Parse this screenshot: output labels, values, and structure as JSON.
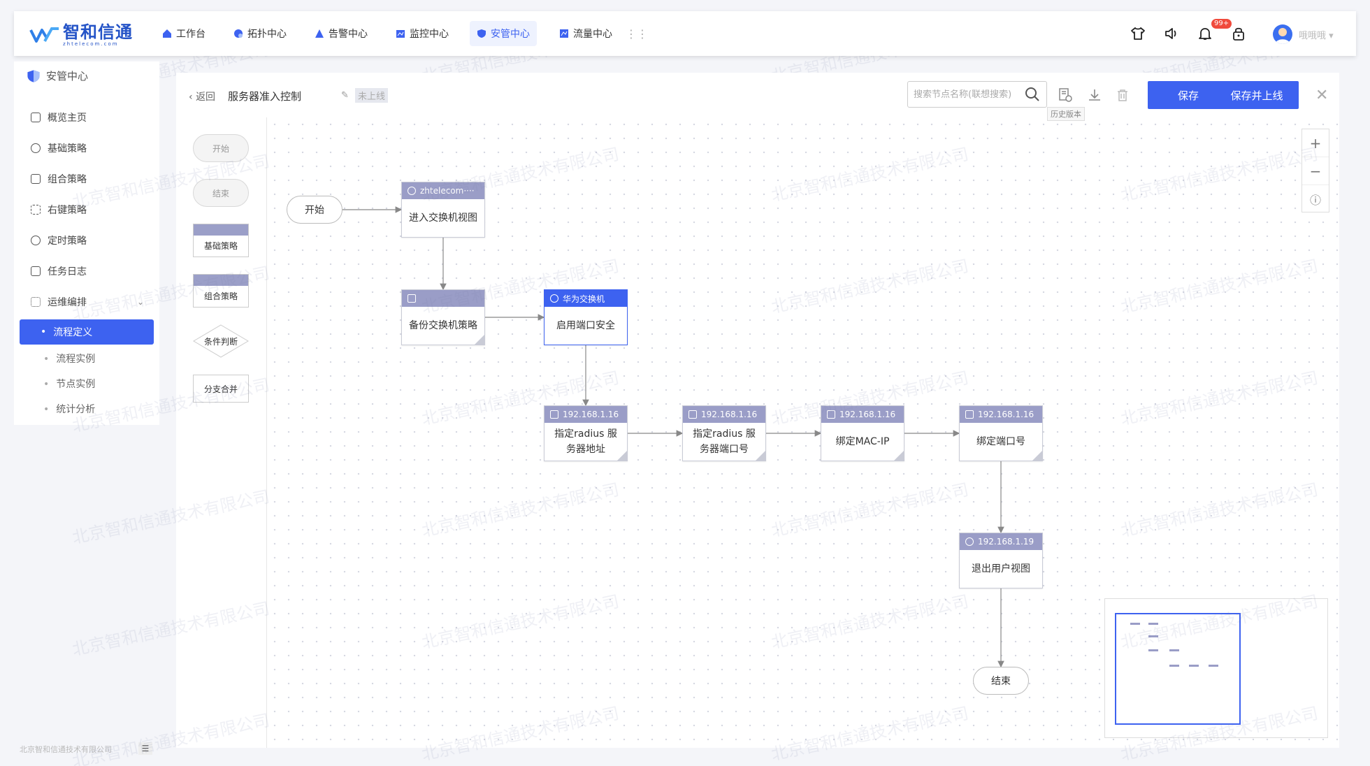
{
  "brand": {
    "name_cn": "智和信通",
    "name_en": "zhtelecom.com"
  },
  "nav": [
    {
      "label": "工作台",
      "icon": "home-icon"
    },
    {
      "label": "拓扑中心",
      "icon": "topology-icon"
    },
    {
      "label": "告警中心",
      "icon": "alarm-icon"
    },
    {
      "label": "监控中心",
      "icon": "monitor-icon"
    },
    {
      "label": "安管中心",
      "icon": "shield-icon"
    },
    {
      "label": "流量中心",
      "icon": "flow-icon"
    }
  ],
  "header": {
    "badge": "99+",
    "username": "哦哦哦"
  },
  "sidebar": {
    "title": "安管中心",
    "items": [
      {
        "label": "概览主页"
      },
      {
        "label": "基础策略"
      },
      {
        "label": "组合策略"
      },
      {
        "label": "右键策略"
      },
      {
        "label": "定时策略"
      },
      {
        "label": "任务日志"
      },
      {
        "label": "运维编排"
      }
    ],
    "sub_items": [
      {
        "label": "流程定义"
      },
      {
        "label": "流程实例"
      },
      {
        "label": "节点实例"
      },
      {
        "label": "统计分析"
      }
    ],
    "footer": "北京智和信通技术有限公司"
  },
  "toolbar": {
    "back_label": "返回",
    "title": "服务器准入控制",
    "status": "未上线",
    "search_placeholder": "搜索节点名称(联想搜索)",
    "history_tooltip": "历史版本",
    "save_label": "保存",
    "save_online_label": "保存并上线"
  },
  "palette": {
    "start": "开始",
    "end": "结束",
    "basic": "基础策略",
    "combo": "组合策略",
    "condition": "条件判断",
    "merge": "分支合并"
  },
  "flow": {
    "start": "开始",
    "end": "结束",
    "nodes": [
      {
        "header": "zhtelecom····",
        "label": "进入交换机视图"
      },
      {
        "header": "",
        "label": "备份交换机策略"
      },
      {
        "header": "华为交换机",
        "label": "启用端口安全"
      },
      {
        "header": "192.168.1.16",
        "label": "指定radius 服务器地址"
      },
      {
        "header": "192.168.1.16",
        "label": "指定radius 服务器端口号"
      },
      {
        "header": "192.168.1.16",
        "label": "绑定MAC-IP"
      },
      {
        "header": "192.168.1.16",
        "label": "绑定端口号"
      },
      {
        "header": "192.168.1.19",
        "label": "退出用户视图"
      }
    ]
  },
  "watermark": "北京智和信通技术有限公司",
  "colors": {
    "accent": "#3d62f0",
    "node_header": "#9a9dc7"
  }
}
